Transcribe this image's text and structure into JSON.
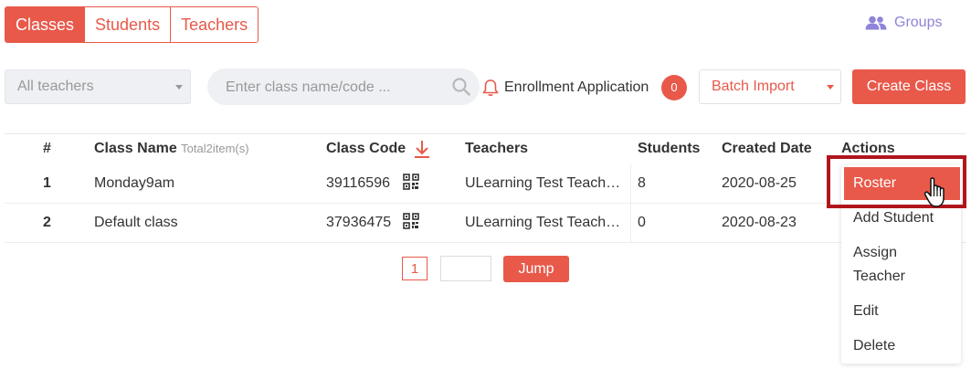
{
  "tabs": [
    {
      "label": "Classes",
      "active": true
    },
    {
      "label": "Students",
      "active": false
    },
    {
      "label": "Teachers",
      "active": false
    }
  ],
  "groups_link": {
    "label": "Groups",
    "icon": "users-icon"
  },
  "toolbar": {
    "teacher_filter": "All teachers",
    "search_placeholder": "Enter class name/code ...",
    "enrollment_label": "Enrollment Application",
    "enrollment_count": "0",
    "batch_import": "Batch Import",
    "create_class": "Create Class"
  },
  "table": {
    "headers": {
      "index": "#",
      "class_name": "Class Name",
      "total": "Total2item(s)",
      "class_code": "Class Code",
      "teachers": "Teachers",
      "students": "Students",
      "created_date": "Created Date",
      "actions": "Actions"
    },
    "rows": [
      {
        "index": "1",
        "name": "Monday9am",
        "code": "39116596",
        "teacher": "ULearning Test Teach…",
        "students": "8",
        "date": "2020-08-25"
      },
      {
        "index": "2",
        "name": "Default class",
        "code": "37936475",
        "teacher": "ULearning Test Teach…",
        "students": "0",
        "date": "2020-08-23"
      }
    ]
  },
  "pagination": {
    "current": "1",
    "jump_label": "Jump"
  },
  "actions_menu": {
    "roster": "Roster",
    "add_student": "Add Student",
    "assign_teacher_line1": "Assign",
    "assign_teacher_line2": "Teacher",
    "edit": "Edit",
    "delete": "Delete"
  },
  "colors": {
    "accent": "#e8594a",
    "groups": "#8e84d9",
    "highlight_box": "#b0151c"
  }
}
